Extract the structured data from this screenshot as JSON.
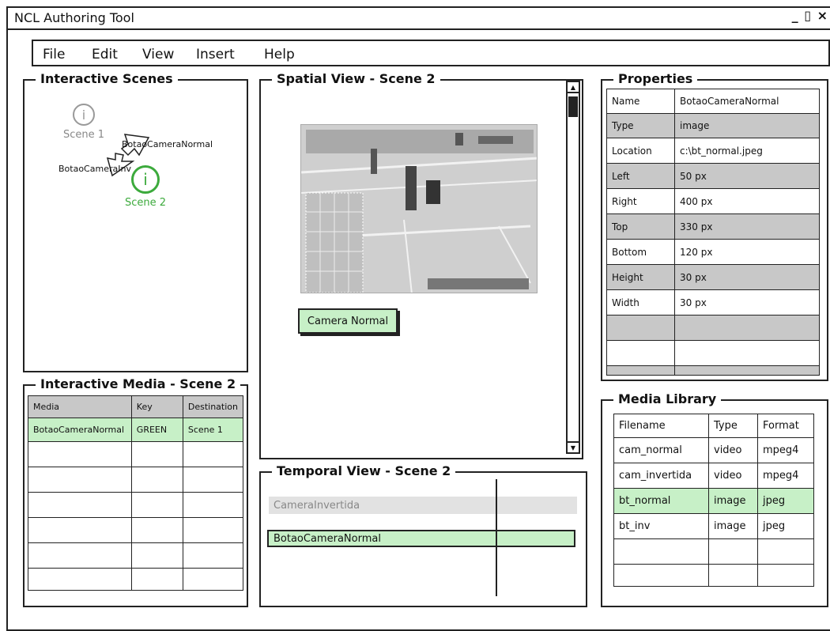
{
  "window": {
    "title": "NCL Authoring Tool",
    "controls": "_ ▯ ×"
  },
  "menu": [
    "File",
    "Edit",
    "View",
    "Insert",
    "Help"
  ],
  "scenes_panel": {
    "title": "Interactive Scenes",
    "scenes": [
      {
        "label": "Scene 1",
        "icon": "i"
      },
      {
        "label": "Scene 2",
        "icon": "i"
      }
    ],
    "edges": [
      "BotaoCameraNormal",
      "BotaoCameraInv"
    ]
  },
  "media_panel": {
    "title": "Interactive Media - Scene 2",
    "columns": [
      "Media",
      "Key",
      "Destination"
    ],
    "rows": [
      [
        "BotaoCameraNormal",
        "GREEN",
        "Scene 1"
      ]
    ]
  },
  "spatial_panel": {
    "title": "Spatial View - Scene 2",
    "button_label": "Camera Normal"
  },
  "temporal_panel": {
    "title": "Temporal View - Scene 2",
    "tracks": [
      "CameraInvertida",
      "BotaoCameraNormal"
    ]
  },
  "properties_panel": {
    "title": "Properties",
    "rows": [
      [
        "Name",
        "BotaoCameraNormal"
      ],
      [
        "Type",
        "image"
      ],
      [
        "Location",
        "c:\\bt_normal.jpeg"
      ],
      [
        "Left",
        "50 px"
      ],
      [
        "Right",
        "400 px"
      ],
      [
        "Top",
        "330 px"
      ],
      [
        "Bottom",
        "120 px"
      ],
      [
        "Height",
        "30 px"
      ],
      [
        "Width",
        "30 px"
      ]
    ]
  },
  "library_panel": {
    "title": "Media Library",
    "columns": [
      "Filename",
      "Type",
      "Format"
    ],
    "rows": [
      [
        "cam_normal",
        "video",
        "mpeg4"
      ],
      [
        "cam_invertida",
        "video",
        "mpeg4"
      ],
      [
        "bt_normal",
        "image",
        "jpeg"
      ],
      [
        "bt_inv",
        "image",
        "jpeg"
      ]
    ]
  },
  "colors": {
    "highlight": "#c7f0c7",
    "active_scene": "#3caa3c",
    "alt_row": "#c8c8c8"
  }
}
